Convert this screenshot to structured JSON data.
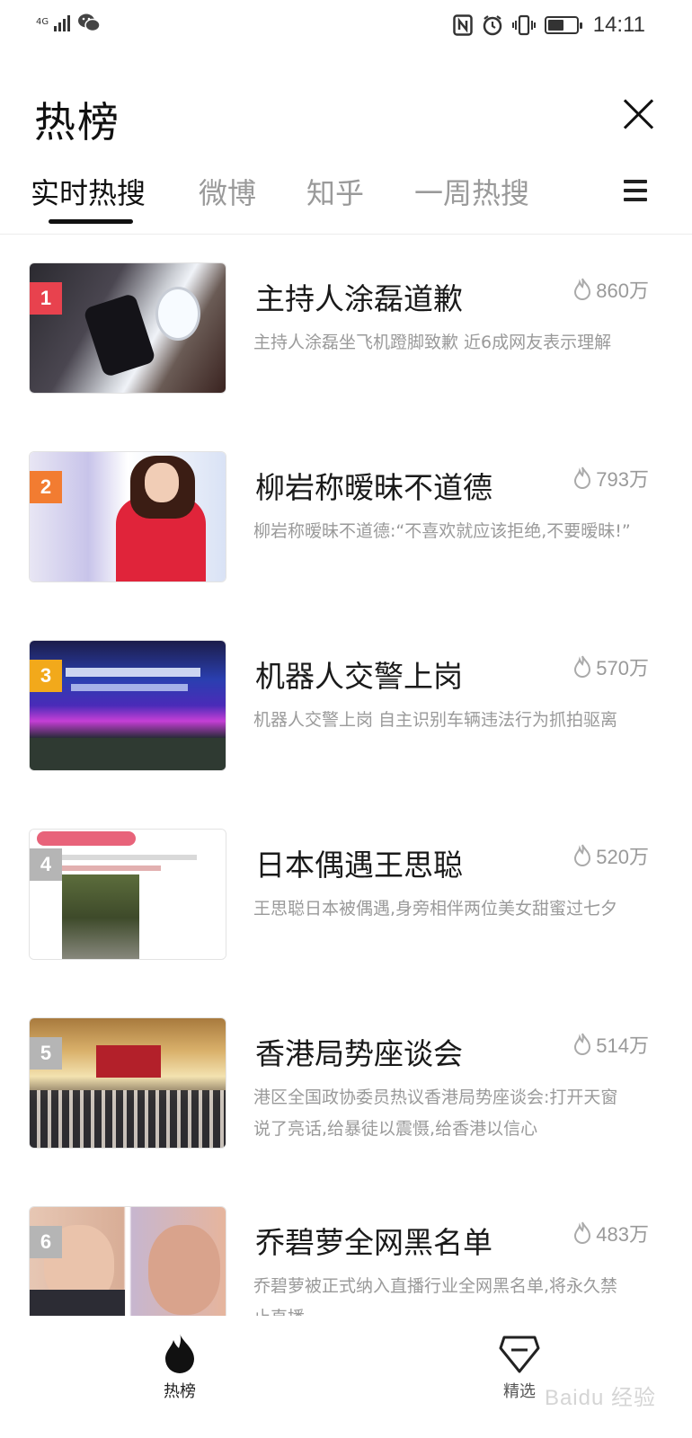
{
  "status_bar": {
    "network": "4G",
    "time": "14:11",
    "icons": [
      "signal-icon",
      "wechat-icon",
      "nfc-icon",
      "alarm-icon",
      "vibrate-icon",
      "battery-icon"
    ],
    "battery_level": 0.55
  },
  "header": {
    "title": "热榜",
    "close_icon": "close-icon"
  },
  "tabs": [
    {
      "label": "实时热搜",
      "active": true
    },
    {
      "label": "微博",
      "active": false
    },
    {
      "label": "知乎",
      "active": false
    },
    {
      "label": "一周热搜",
      "active": false
    }
  ],
  "menu_icon": "menu-icon",
  "items": [
    {
      "rank": "1",
      "title": "主持人涂磊道歉",
      "heat": "860万",
      "desc": "主持人涂磊坐飞机蹬脚致歉 近6成网友表示理解",
      "rank_color": "#e8424e"
    },
    {
      "rank": "2",
      "title": "柳岩称暧昧不道德",
      "heat": "793万",
      "desc": "柳岩称暧昧不道德:“不喜欢就应该拒绝,不要暧昧!”",
      "rank_color": "#f27c31"
    },
    {
      "rank": "3",
      "title": "机器人交警上岗",
      "heat": "570万",
      "desc": "机器人交警上岗 自主识别车辆违法行为抓拍驱离",
      "rank_color": "#f2a91b"
    },
    {
      "rank": "4",
      "title": "日本偶遇王思聪",
      "heat": "520万",
      "desc": "王思聪日本被偶遇,身旁相伴两位美女甜蜜过七夕",
      "rank_color": "#b5b5b5"
    },
    {
      "rank": "5",
      "title": "香港局势座谈会",
      "heat": "514万",
      "desc": "港区全国政协委员热议香港局势座谈会:打开天窗说了亮话,给暴徒以震慑,给香港以信心",
      "rank_color": "#b5b5b5"
    },
    {
      "rank": "6",
      "title": "乔碧萝全网黑名单",
      "heat": "483万",
      "desc": "乔碧萝被正式纳入直播行业全网黑名单,将永久禁止直播",
      "rank_color": "#b5b5b5"
    }
  ],
  "bottom_nav": [
    {
      "label": "热榜",
      "icon": "flame-icon",
      "active": true
    },
    {
      "label": "精选",
      "icon": "gem-icon",
      "active": false
    }
  ],
  "watermark": "Baidu 经验"
}
